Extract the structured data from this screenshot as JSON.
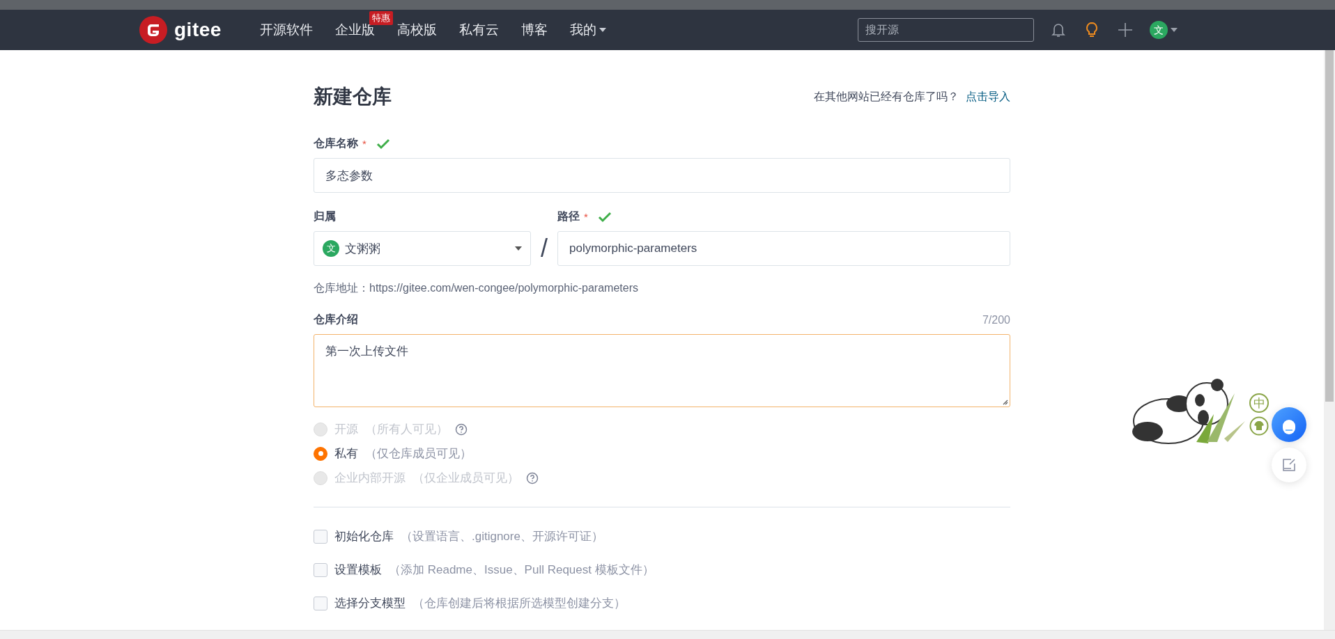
{
  "nav": {
    "logo": "gitee",
    "items": [
      {
        "label": "开源软件"
      },
      {
        "label": "企业版",
        "badge": "特惠"
      },
      {
        "label": "高校版"
      },
      {
        "label": "私有云"
      },
      {
        "label": "博客"
      },
      {
        "label": "我的",
        "dropdown": true
      }
    ],
    "search": {
      "placeholder": "搜开源"
    },
    "avatar": "文"
  },
  "header": {
    "title": "新建仓库",
    "import_prompt": "在其他网站已经有仓库了吗？",
    "import_link": "点击导入"
  },
  "name_field": {
    "label": "仓库名称",
    "required_mark": "*",
    "valid": true,
    "value": "多态参数"
  },
  "owner_field": {
    "label": "归属",
    "avatar": "文",
    "value": "文粥粥"
  },
  "separator": "/",
  "path_field": {
    "label": "路径",
    "required_mark": "*",
    "valid": true,
    "value": "polymorphic-parameters"
  },
  "address": "仓库地址：https://gitee.com/wen-congee/polymorphic-parameters",
  "intro_field": {
    "label": "仓库介绍",
    "counter": "7/200",
    "value": "第一次上传文件",
    "focused": true
  },
  "visibility": [
    {
      "label": "开源",
      "hint": "（所有人可见）",
      "selected": false,
      "disabled": true,
      "help": true
    },
    {
      "label": "私有",
      "hint": "（仅仓库成员可见）",
      "selected": true,
      "disabled": false,
      "help": false
    },
    {
      "label": "企业内部开源",
      "hint": "（仅企业成员可见）",
      "selected": false,
      "disabled": true,
      "help": true
    }
  ],
  "options": [
    {
      "label": "初始化仓库",
      "hint": "（设置语言、.gitignore、开源许可证）",
      "checked": false
    },
    {
      "label": "设置模板",
      "hint": "（添加 Readme、Issue、Pull Request 模板文件）",
      "checked": false
    },
    {
      "label": "选择分支模型",
      "hint": "（仓库创建后将根据所选模型创建分支）",
      "checked": false
    }
  ],
  "ime": {
    "label": "中"
  }
}
